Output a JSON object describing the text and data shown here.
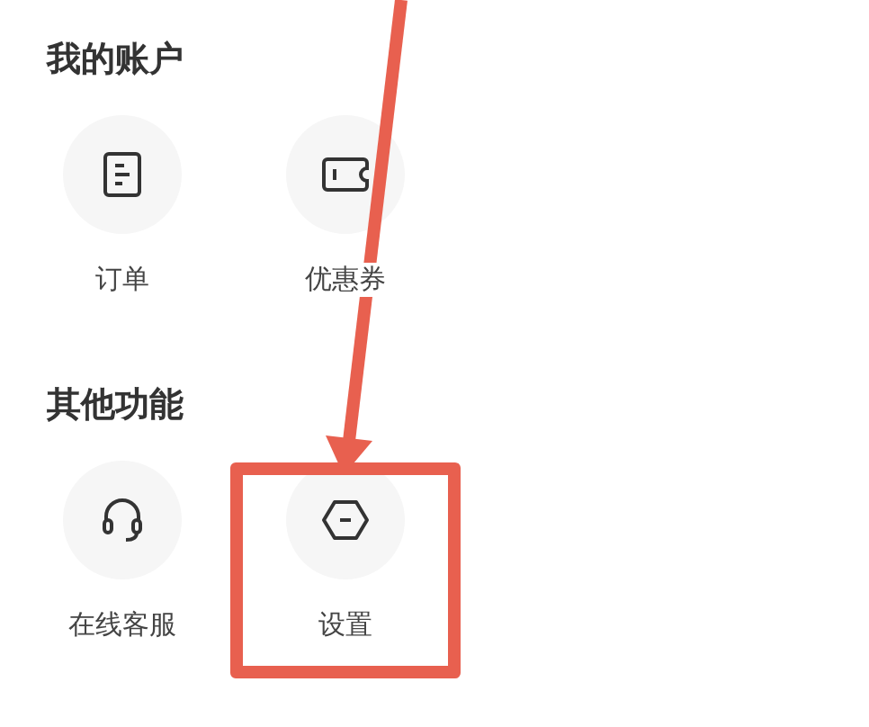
{
  "sections": [
    {
      "title": "我的账户",
      "items": [
        {
          "kind": "order",
          "label": "订单",
          "highlighted": false
        },
        {
          "kind": "coupon",
          "label": "优惠券",
          "highlighted": false
        }
      ]
    },
    {
      "title": "其他功能",
      "items": [
        {
          "kind": "service",
          "label": "在线客服",
          "highlighted": false
        },
        {
          "kind": "settings",
          "label": "设置",
          "highlighted": true
        }
      ]
    }
  ]
}
